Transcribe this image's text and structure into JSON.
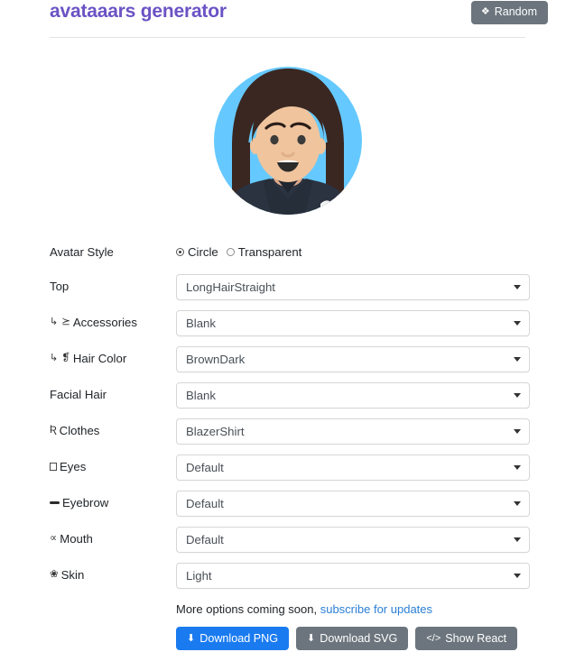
{
  "header": {
    "title": "avataaars generator",
    "random_label": "Random",
    "random_icon": "shuffle-icon"
  },
  "avatar": {
    "alt": "avatar-preview",
    "background_color": "#65C9FF",
    "skin_color": "#F0C49D",
    "hair_color": "#3A2721",
    "clothes_color": "#2B3340",
    "mouth_color": "#2B2B2B"
  },
  "form": {
    "avatar_style": {
      "label": "Avatar Style",
      "options": [
        "Circle",
        "Transparent"
      ],
      "selected": "Circle"
    },
    "fields": [
      {
        "name": "top",
        "label": "Top",
        "icon": "",
        "sub": false,
        "value": "LongHairStraight"
      },
      {
        "name": "accessories",
        "label": "Accessories",
        "icon": "⪰",
        "icon_kind": "glasses",
        "sub": true,
        "value": "Blank"
      },
      {
        "name": "hair-color",
        "label": "Hair Color",
        "icon": "❡",
        "icon_kind": "paint",
        "sub": true,
        "value": "BrownDark"
      },
      {
        "name": "facial-hair",
        "label": "Facial Hair",
        "icon": "",
        "sub": false,
        "value": "Blank"
      },
      {
        "name": "clothes",
        "label": "Clothes",
        "icon": "Ʀ",
        "icon_kind": "tshirt",
        "sub": false,
        "value": "BlazerShirt"
      },
      {
        "name": "eyes",
        "label": "Eyes",
        "icon": "",
        "icon_kind": "box",
        "sub": false,
        "value": "Default"
      },
      {
        "name": "eyebrow",
        "label": "Eyebrow",
        "icon": "",
        "icon_kind": "brow",
        "sub": false,
        "value": "Default"
      },
      {
        "name": "mouth",
        "label": "Mouth",
        "icon": "∝",
        "icon_kind": "mouth",
        "sub": false,
        "value": "Default"
      },
      {
        "name": "skin",
        "label": "Skin",
        "icon": "❀",
        "icon_kind": "palette",
        "sub": false,
        "value": "Light"
      }
    ],
    "sub_arrow": "↳"
  },
  "footer": {
    "note_text": "More options coming soon,",
    "note_link": "subscribe for updates",
    "buttons": [
      {
        "name": "download-png",
        "label": "Download PNG",
        "icon": "⬇",
        "style": "primary"
      },
      {
        "name": "download-svg",
        "label": "Download SVG",
        "icon": "⬇",
        "style": "secondary"
      },
      {
        "name": "show-react",
        "label": "Show React",
        "icon": "</>",
        "style": "secondary"
      }
    ]
  },
  "colors": {
    "accent": "#6b53c4",
    "primary_button": "#1a7bf0",
    "secondary_button": "#6c757d",
    "link": "#2b7fd4"
  }
}
